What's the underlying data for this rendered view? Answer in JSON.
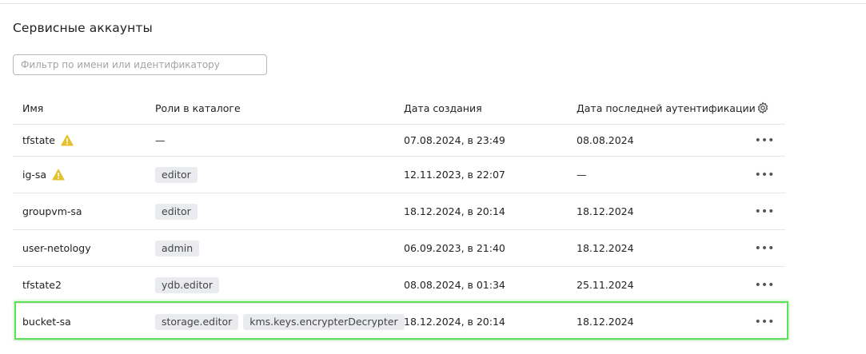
{
  "page": {
    "title": "Сервисные аккаунты"
  },
  "filter": {
    "placeholder": "Фильтр по имени или идентификатору",
    "value": ""
  },
  "table": {
    "columns": {
      "name": "Имя",
      "roles": "Роли в каталоге",
      "created": "Дата создания",
      "last_auth": "Дата последней аутентификации"
    },
    "settings_icon": "gear-icon",
    "row_menu_icon": "more-horizontal-icon",
    "warning_icon": "warning-triangle-icon",
    "warning_color": "#e5c12e",
    "highlight_color": "#5fe05a",
    "rows": [
      {
        "name": "tfstate",
        "warning": true,
        "roles": [],
        "roles_empty": "—",
        "created": "07.08.2024, в 23:49",
        "last_auth": "08.08.2024",
        "menu": "•••"
      },
      {
        "name": "ig-sa",
        "warning": true,
        "roles": [
          "editor"
        ],
        "created": "12.11.2023, в 22:07",
        "last_auth": "—",
        "menu": "•••"
      },
      {
        "name": "groupvm-sa",
        "warning": false,
        "roles": [
          "editor"
        ],
        "created": "18.12.2024, в 20:14",
        "last_auth": "18.12.2024",
        "menu": "•••"
      },
      {
        "name": "user-netology",
        "warning": false,
        "roles": [
          "admin"
        ],
        "created": "06.09.2023, в 21:40",
        "last_auth": "18.12.2024",
        "menu": "•••"
      },
      {
        "name": "tfstate2",
        "warning": false,
        "roles": [
          "ydb.editor"
        ],
        "created": "08.08.2024, в 01:34",
        "last_auth": "25.11.2024",
        "menu": "•••"
      },
      {
        "name": "bucket-sa",
        "warning": false,
        "highlighted": true,
        "roles": [
          "storage.editor",
          "kms.keys.encrypterDecrypter"
        ],
        "created": "18.12.2024, в 20:14",
        "last_auth": "18.12.2024",
        "menu": "•••"
      }
    ]
  }
}
